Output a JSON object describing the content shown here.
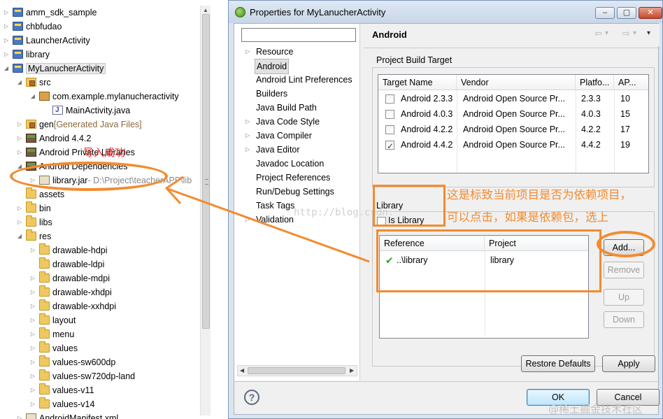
{
  "explorer": {
    "items": [
      {
        "label": "amm_sdk_sample",
        "extra": "",
        "icon": "project-icon",
        "expanded": false
      },
      {
        "label": "chbfudao",
        "extra": "",
        "icon": "project-icon",
        "expanded": false
      },
      {
        "label": "LauncherActivity",
        "extra": "",
        "icon": "project-icon",
        "expanded": false
      },
      {
        "label": "library",
        "extra": "",
        "icon": "project-icon",
        "expanded": false
      },
      {
        "label": "MyLanucherActivity",
        "extra": "",
        "icon": "project-icon",
        "expanded": true
      },
      {
        "label": "src",
        "extra": "",
        "icon": "source-folder-icon",
        "expanded": true
      },
      {
        "label": "com.example.mylanucheractivity",
        "extra": "",
        "icon": "package-icon",
        "expanded": true
      },
      {
        "label": "MainActivity.java",
        "extra": "",
        "icon": "java-file-icon",
        "expanded": false
      },
      {
        "label": "gen",
        "extra": "[Generated Java Files]",
        "icon": "source-folder-icon",
        "expanded": false
      },
      {
        "label": "Android 4.4.2",
        "extra": "",
        "icon": "library-icon",
        "expanded": false
      },
      {
        "label": "Android Private Libraries",
        "extra": "",
        "icon": "library-icon",
        "expanded": false
      },
      {
        "label": "Android Dependencies",
        "extra": "",
        "icon": "library-icon",
        "expanded": true
      },
      {
        "label": "library.jar",
        "extra": "- D:\\Project\\teacherAPP\\lib",
        "icon": "jar-icon",
        "expanded": false
      },
      {
        "label": "assets",
        "extra": "",
        "icon": "folder-icon",
        "expanded": false
      },
      {
        "label": "bin",
        "extra": "",
        "icon": "folder-icon",
        "expanded": false
      },
      {
        "label": "libs",
        "extra": "",
        "icon": "folder-icon",
        "expanded": false
      },
      {
        "label": "res",
        "extra": "",
        "icon": "folder-icon",
        "expanded": true
      },
      {
        "label": "drawable-hdpi",
        "extra": "",
        "icon": "folder-icon",
        "expanded": false
      },
      {
        "label": "drawable-ldpi",
        "extra": "",
        "icon": "folder-icon",
        "expanded": false
      },
      {
        "label": "drawable-mdpi",
        "extra": "",
        "icon": "folder-icon",
        "expanded": false
      },
      {
        "label": "drawable-xhdpi",
        "extra": "",
        "icon": "folder-icon",
        "expanded": false
      },
      {
        "label": "drawable-xxhdpi",
        "extra": "",
        "icon": "folder-icon",
        "expanded": false
      },
      {
        "label": "layout",
        "extra": "",
        "icon": "folder-icon",
        "expanded": false
      },
      {
        "label": "menu",
        "extra": "",
        "icon": "folder-icon",
        "expanded": false
      },
      {
        "label": "values",
        "extra": "",
        "icon": "folder-icon",
        "expanded": false
      },
      {
        "label": "values-sw600dp",
        "extra": "",
        "icon": "folder-icon",
        "expanded": false
      },
      {
        "label": "values-sw720dp-land",
        "extra": "",
        "icon": "folder-icon",
        "expanded": false
      },
      {
        "label": "values-v11",
        "extra": "",
        "icon": "folder-icon",
        "expanded": false
      },
      {
        "label": "values-v14",
        "extra": "",
        "icon": "folder-icon",
        "expanded": false
      },
      {
        "label": "AndroidManifest.xml",
        "extra": "",
        "icon": "xml-file-icon",
        "expanded": false
      }
    ]
  },
  "dialog": {
    "title": "Properties for MyLanucherActivity",
    "window_buttons": {
      "minimize": "‒",
      "maximize": "▢",
      "close": "✕"
    },
    "filter_placeholder": "",
    "nav_items": [
      {
        "label": "Resource",
        "has_children": true,
        "selected": false
      },
      {
        "label": "Android",
        "has_children": false,
        "selected": true
      },
      {
        "label": "Android Lint Preferences",
        "has_children": false,
        "selected": false
      },
      {
        "label": "Builders",
        "has_children": false,
        "selected": false
      },
      {
        "label": "Java Build Path",
        "has_children": false,
        "selected": false
      },
      {
        "label": "Java Code Style",
        "has_children": true,
        "selected": false
      },
      {
        "label": "Java Compiler",
        "has_children": true,
        "selected": false
      },
      {
        "label": "Java Editor",
        "has_children": true,
        "selected": false
      },
      {
        "label": "Javadoc Location",
        "has_children": false,
        "selected": false
      },
      {
        "label": "Project References",
        "has_children": false,
        "selected": false
      },
      {
        "label": "Run/Debug Settings",
        "has_children": false,
        "selected": false
      },
      {
        "label": "Task Tags",
        "has_children": false,
        "selected": false
      },
      {
        "label": "Validation",
        "has_children": true,
        "selected": false
      }
    ],
    "page": {
      "title": "Android",
      "nav_arrows": {
        "back": "⇦",
        "back_menu": "▾",
        "forward": "⇨",
        "forward_menu": "▾",
        "menu": "▾"
      },
      "build_target": {
        "group_label": "Project Build Target",
        "columns": [
          "Target Name",
          "Vendor",
          "Platfo...",
          "AP..."
        ],
        "rows": [
          {
            "name": "Android 2.3.3",
            "vendor": "Android Open Source Pr...",
            "platform": "2.3.3",
            "api": "10",
            "checked": false
          },
          {
            "name": "Android 4.0.3",
            "vendor": "Android Open Source Pr...",
            "platform": "4.0.3",
            "api": "15",
            "checked": false
          },
          {
            "name": "Android 4.2.2",
            "vendor": "Android Open Source Pr...",
            "platform": "4.2.2",
            "api": "17",
            "checked": false
          },
          {
            "name": "Android 4.4.2",
            "vendor": "Android Open Source Pr...",
            "platform": "4.4.2",
            "api": "19",
            "checked": true
          }
        ]
      },
      "library": {
        "group_label": "Library",
        "is_library_label": "Is Library",
        "is_library_checked": false,
        "columns": [
          "Reference",
          "Project"
        ],
        "rows": [
          {
            "reference": "..\\library",
            "project": "library",
            "status": "ok"
          }
        ],
        "buttons": {
          "add": "Add...",
          "remove": "Remove",
          "up": "Up",
          "down": "Down"
        }
      },
      "restore_defaults": "Restore Defaults",
      "apply": "Apply"
    },
    "footer": {
      "help": "?",
      "ok": "OK",
      "cancel": "Cancel"
    }
  },
  "annotations": {
    "import_success": "导入成功",
    "library_note_line1": "这是标致当前项目是否为依赖项目，",
    "library_note_line2": "可以点击，如果是依赖包，选上",
    "watermark": "http://blog.csdn.",
    "credit": "@稀土掘金技术社区",
    "color": "#f28b30"
  }
}
